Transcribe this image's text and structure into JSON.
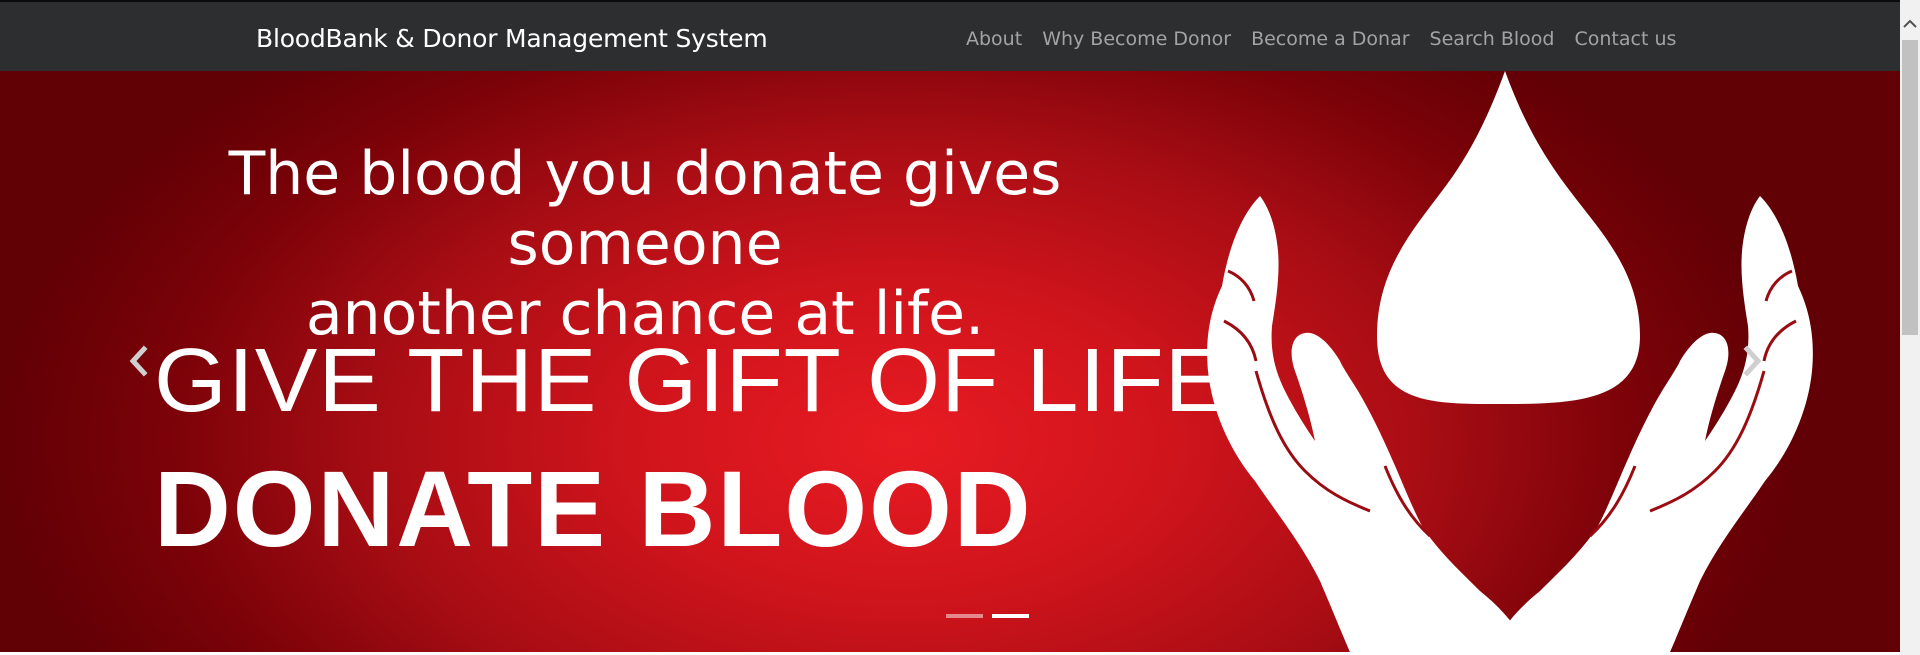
{
  "navbar": {
    "brand": "BloodBank & Donor Management System",
    "links": [
      {
        "label": "About"
      },
      {
        "label": "Why Become Donor"
      },
      {
        "label": "Become a Donar"
      },
      {
        "label": "Search Blood"
      },
      {
        "label": "Contact us"
      }
    ],
    "background": "#2d2e30",
    "link_color": "#a3a3a3"
  },
  "carousel": {
    "slide_text": {
      "tagline_line1": "The blood you donate gives someone",
      "tagline_line2": "another chance at life.",
      "headline": "GIVE THE GIFT OF LIFE",
      "subheadline": "DONATE BLOOD"
    },
    "indicators": [
      {
        "active": false
      },
      {
        "active": true
      }
    ],
    "controls": {
      "prev_icon": "chevron-left-icon",
      "next_icon": "chevron-right-icon"
    },
    "colors": {
      "center": "#e81b22",
      "edge": "#610005"
    }
  },
  "scrollbar": {
    "up_icon": "chevron-up-icon"
  }
}
